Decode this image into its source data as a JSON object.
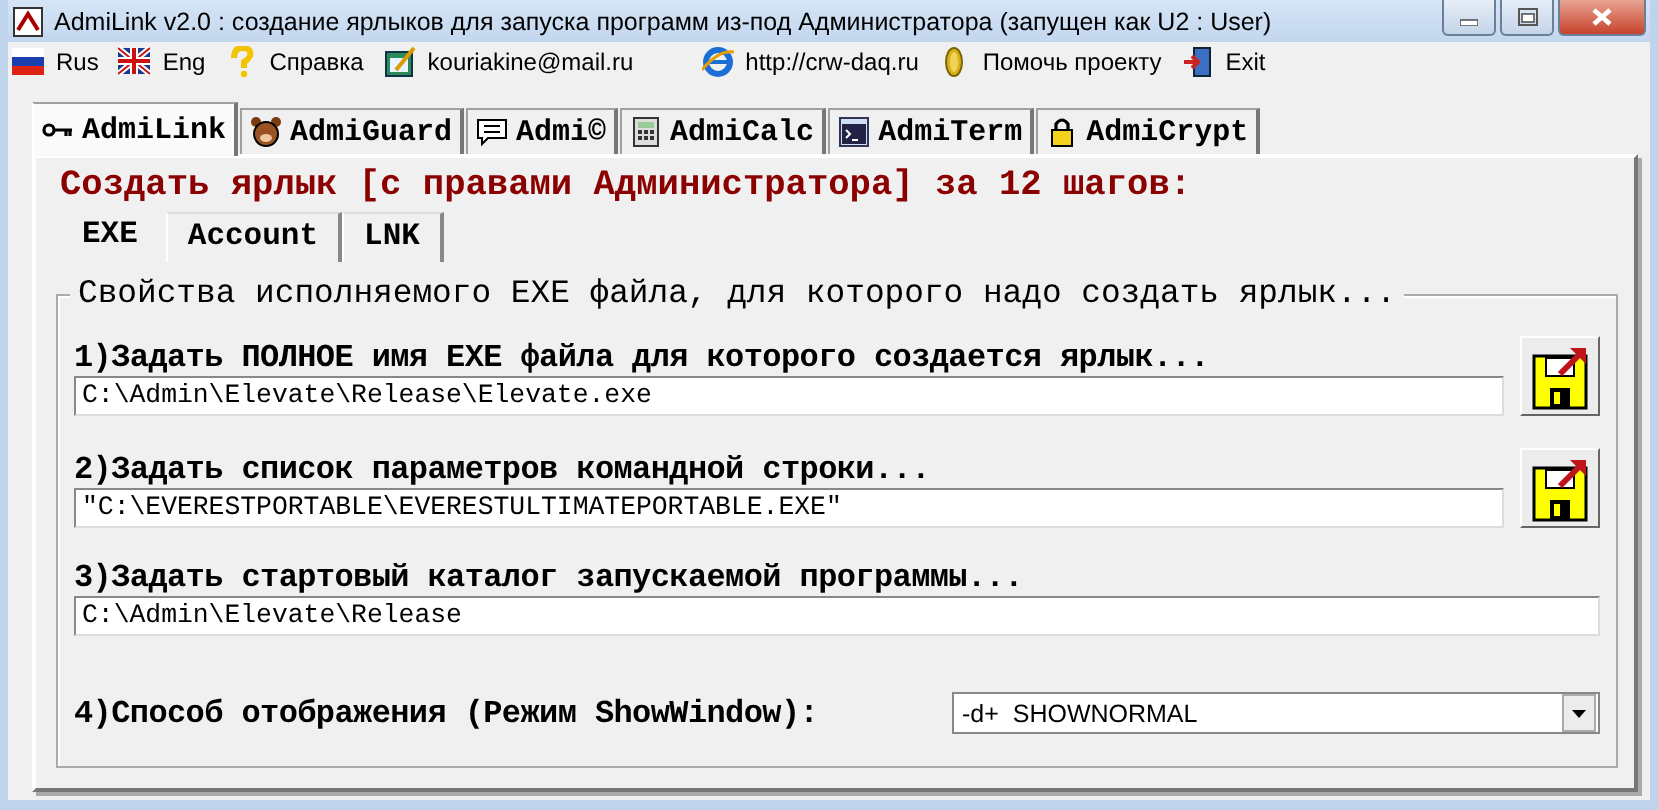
{
  "window": {
    "title": "AdmiLink v2.0 : создание ярлыков для запуска программ из-под Администратора (запущен как U2 : User)"
  },
  "menu": [
    {
      "label": "Rus"
    },
    {
      "label": "Eng"
    },
    {
      "label": "Справка"
    },
    {
      "label": "kouriakine@mail.ru"
    },
    {
      "label": "http://crw-daq.ru"
    },
    {
      "label": "Помочь проекту"
    },
    {
      "label": "Exit"
    }
  ],
  "tabs": [
    {
      "label": "AdmiLink",
      "selected": true
    },
    {
      "label": "AdmiGuard",
      "selected": false
    },
    {
      "label": "Admi©",
      "selected": false
    },
    {
      "label": "AdmiCalc",
      "selected": false
    },
    {
      "label": "AdmiTerm",
      "selected": false
    },
    {
      "label": "AdmiCrypt",
      "selected": false
    }
  ],
  "heading": "Создать ярлык [с правами Администратора] за 12 шагов:",
  "subtabs": [
    {
      "label": "EXE",
      "selected": true
    },
    {
      "label": "Account",
      "selected": false
    },
    {
      "label": "LNK",
      "selected": false
    }
  ],
  "group": {
    "legend": "Свойства исполняемого EXE файла, для которого надо создать ярлык...",
    "fields": [
      {
        "kind": "browse",
        "label": "1)Задать ПОЛНОЕ имя EXE файла для которого создается ярлык...",
        "value": "C:\\Admin\\Elevate\\Release\\Elevate.exe"
      },
      {
        "kind": "browse",
        "label": "2)Задать список параметров командной строки...",
        "value": "\"C:\\EVERESTPORTABLE\\EVERESTULTIMATEPORTABLE.EXE\""
      },
      {
        "kind": "text",
        "label": "3)Задать стартовый каталог запускаемой программы...",
        "value": "C:\\Admin\\Elevate\\Release"
      },
      {
        "kind": "combo",
        "label": "4)Способ отображения (Режим ShowWindow):",
        "value": "-d+  SHOWNORMAL"
      }
    ]
  }
}
